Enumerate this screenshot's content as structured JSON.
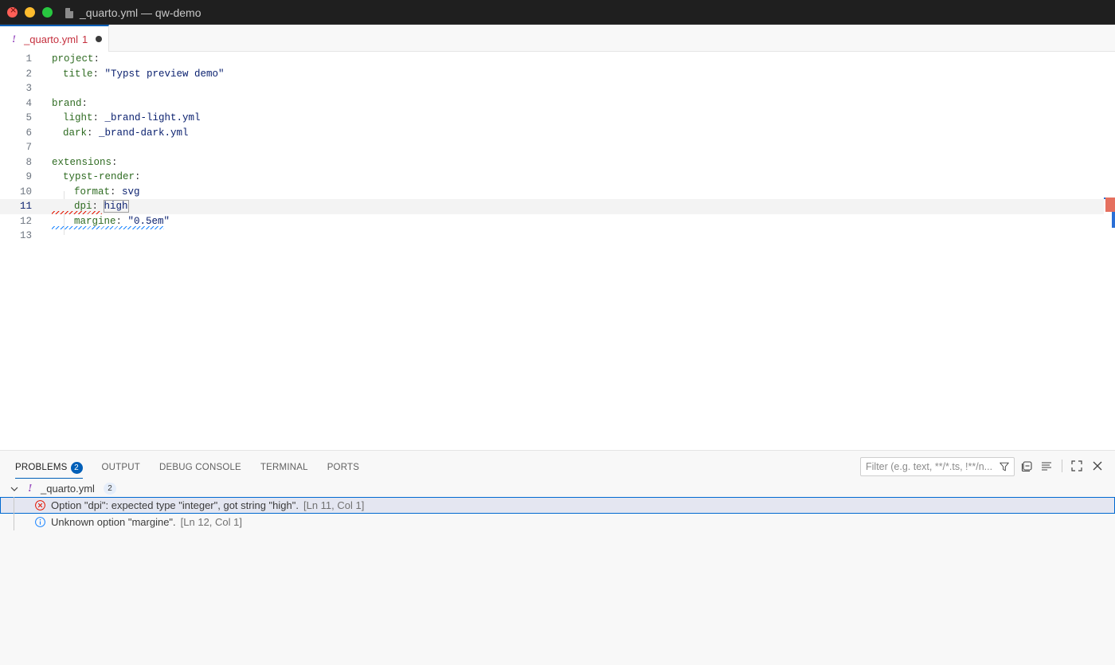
{
  "window": {
    "title": "_quarto.yml — qw-demo"
  },
  "tab": {
    "warn_symbol": "!",
    "filename": "_quarto.yml",
    "problem_count": "1"
  },
  "editor": {
    "lines": [
      {
        "num": "1",
        "key": "project",
        "sep": ":",
        "value": ""
      },
      {
        "num": "2",
        "key": "title",
        "sep": ": ",
        "value": "\"Typst preview demo\""
      },
      {
        "num": "3",
        "key": "",
        "sep": "",
        "value": ""
      },
      {
        "num": "4",
        "key": "brand",
        "sep": ":",
        "value": ""
      },
      {
        "num": "5",
        "key": "light",
        "sep": ": ",
        "value": "_brand-light.yml"
      },
      {
        "num": "6",
        "key": "dark",
        "sep": ": ",
        "value": "_brand-dark.yml"
      },
      {
        "num": "7",
        "key": "",
        "sep": "",
        "value": ""
      },
      {
        "num": "8",
        "key": "extensions",
        "sep": ":",
        "value": ""
      },
      {
        "num": "9",
        "key": "typst-render",
        "sep": ":",
        "value": ""
      },
      {
        "num": "10",
        "key": "format",
        "sep": ": ",
        "value": "svg"
      },
      {
        "num": "11",
        "key": "dpi",
        "sep": ": ",
        "value": "high"
      },
      {
        "num": "12",
        "key": "margine",
        "sep": ": ",
        "value": "\"0.5em\""
      },
      {
        "num": "13",
        "key": "",
        "sep": "",
        "value": ""
      }
    ],
    "current_line": "11"
  },
  "panel": {
    "tabs": [
      {
        "label": "PROBLEMS",
        "badge": "2"
      },
      {
        "label": "OUTPUT"
      },
      {
        "label": "DEBUG CONSOLE"
      },
      {
        "label": "TERMINAL"
      },
      {
        "label": "PORTS"
      }
    ],
    "filter_placeholder": "Filter (e.g. text, **/*.ts, !**/n...",
    "file": {
      "warn_symbol": "!",
      "name": "_quarto.yml",
      "count": "2"
    },
    "problems": [
      {
        "severity": "error",
        "message": "Option \"dpi\": expected type \"integer\", got string \"high\".",
        "location": "[Ln 11, Col 1]"
      },
      {
        "severity": "info",
        "message": "Unknown option \"margine\".",
        "location": "[Ln 12, Col 1]"
      }
    ]
  },
  "colors": {
    "accent": "#005fb8",
    "error": "#e51400",
    "info": "#1a85ff",
    "yaml_key": "#2e6b21",
    "yaml_value": "#0b216f"
  }
}
